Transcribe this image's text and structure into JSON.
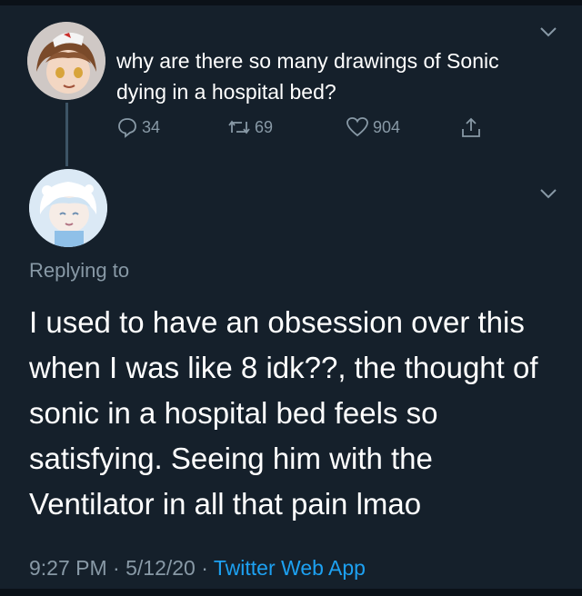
{
  "original_tweet": {
    "avatar_icon": "anime-avatar-icon",
    "text_line_1": "why are there so many drawings of Sonic",
    "text_line_2": "dying in a hospital bed?",
    "actions": {
      "reply_count": "34",
      "retweet_count": "69",
      "like_count": "904"
    }
  },
  "reply_tweet": {
    "avatar_icon": "chibi-avatar-icon",
    "replying_label": "Replying to",
    "lines": [
      "I used to have an obsession over this",
      "when I was like 8 idk??, the thought of",
      "sonic in a hospital bed feels so",
      "satisfying. Seeing him with the",
      "Ventilator in all that pain lmao"
    ],
    "time": "9:27 PM",
    "date": "5/12/20",
    "separator": "·",
    "source": "Twitter Web App"
  },
  "colors": {
    "background": "#15202b",
    "text": "#ffffff",
    "muted": "#8899a6",
    "link": "#1da1f2"
  }
}
